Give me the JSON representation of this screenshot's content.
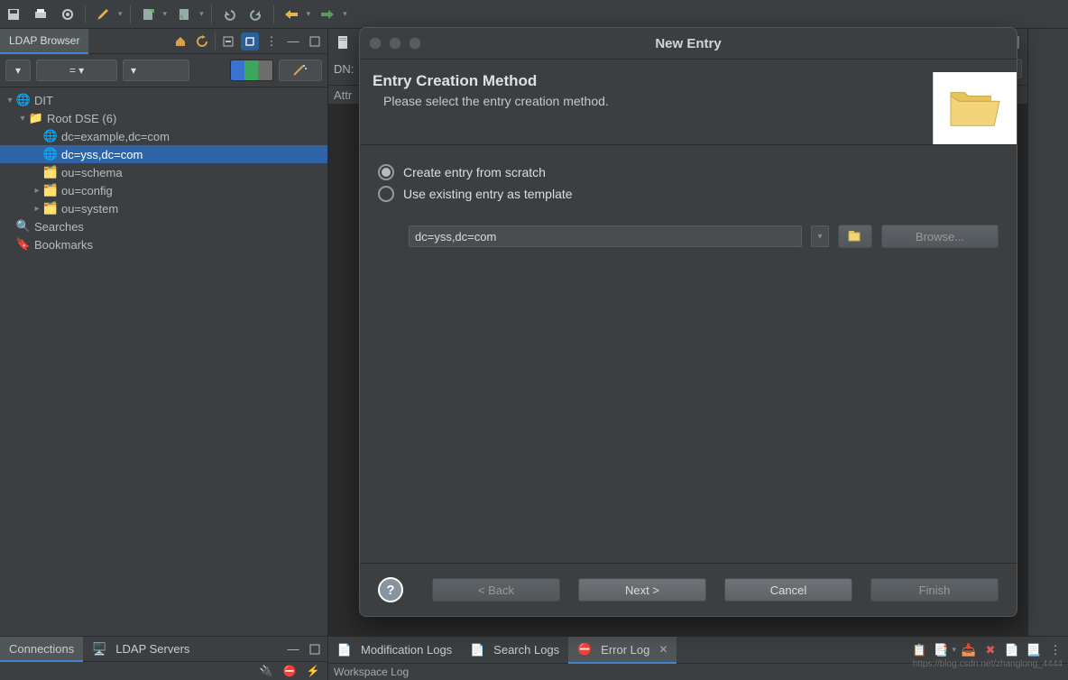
{
  "toolbar": {
    "icons": [
      "save",
      "print",
      "settings",
      "edit",
      "new-attr",
      "new-val",
      "undo",
      "redo",
      "back",
      "forward"
    ]
  },
  "leftPanel": {
    "tab": "LDAP Browser",
    "filter": {
      "eq": "="
    },
    "tree": {
      "root": "DIT",
      "rootDse": "Root DSE (6)",
      "items": [
        "dc=example,dc=com",
        "dc=yss,dc=com",
        "ou=schema",
        "ou=config",
        "ou=system"
      ],
      "searches": "Searches",
      "bookmarks": "Bookmarks"
    }
  },
  "editor": {
    "dnLabel": "DN:",
    "attrHeader": "Attr"
  },
  "dialog": {
    "title": "New Entry",
    "heading": "Entry Creation Method",
    "subtitle": "Please select the entry creation method.",
    "option1": "Create entry from scratch",
    "option2": "Use existing entry as template",
    "templateValue": "dc=yss,dc=com",
    "browse": "Browse...",
    "back": "< Back",
    "next": "Next >",
    "cancel": "Cancel",
    "finish": "Finish"
  },
  "bottom": {
    "connections": "Connections",
    "ldapServers": "LDAP Servers",
    "modLogs": "Modification Logs",
    "searchLogs": "Search Logs",
    "errorLog": "Error Log",
    "workspaceLog": "Workspace Log"
  },
  "watermark": "https://blog.csdn.net/zhanglong_4444"
}
